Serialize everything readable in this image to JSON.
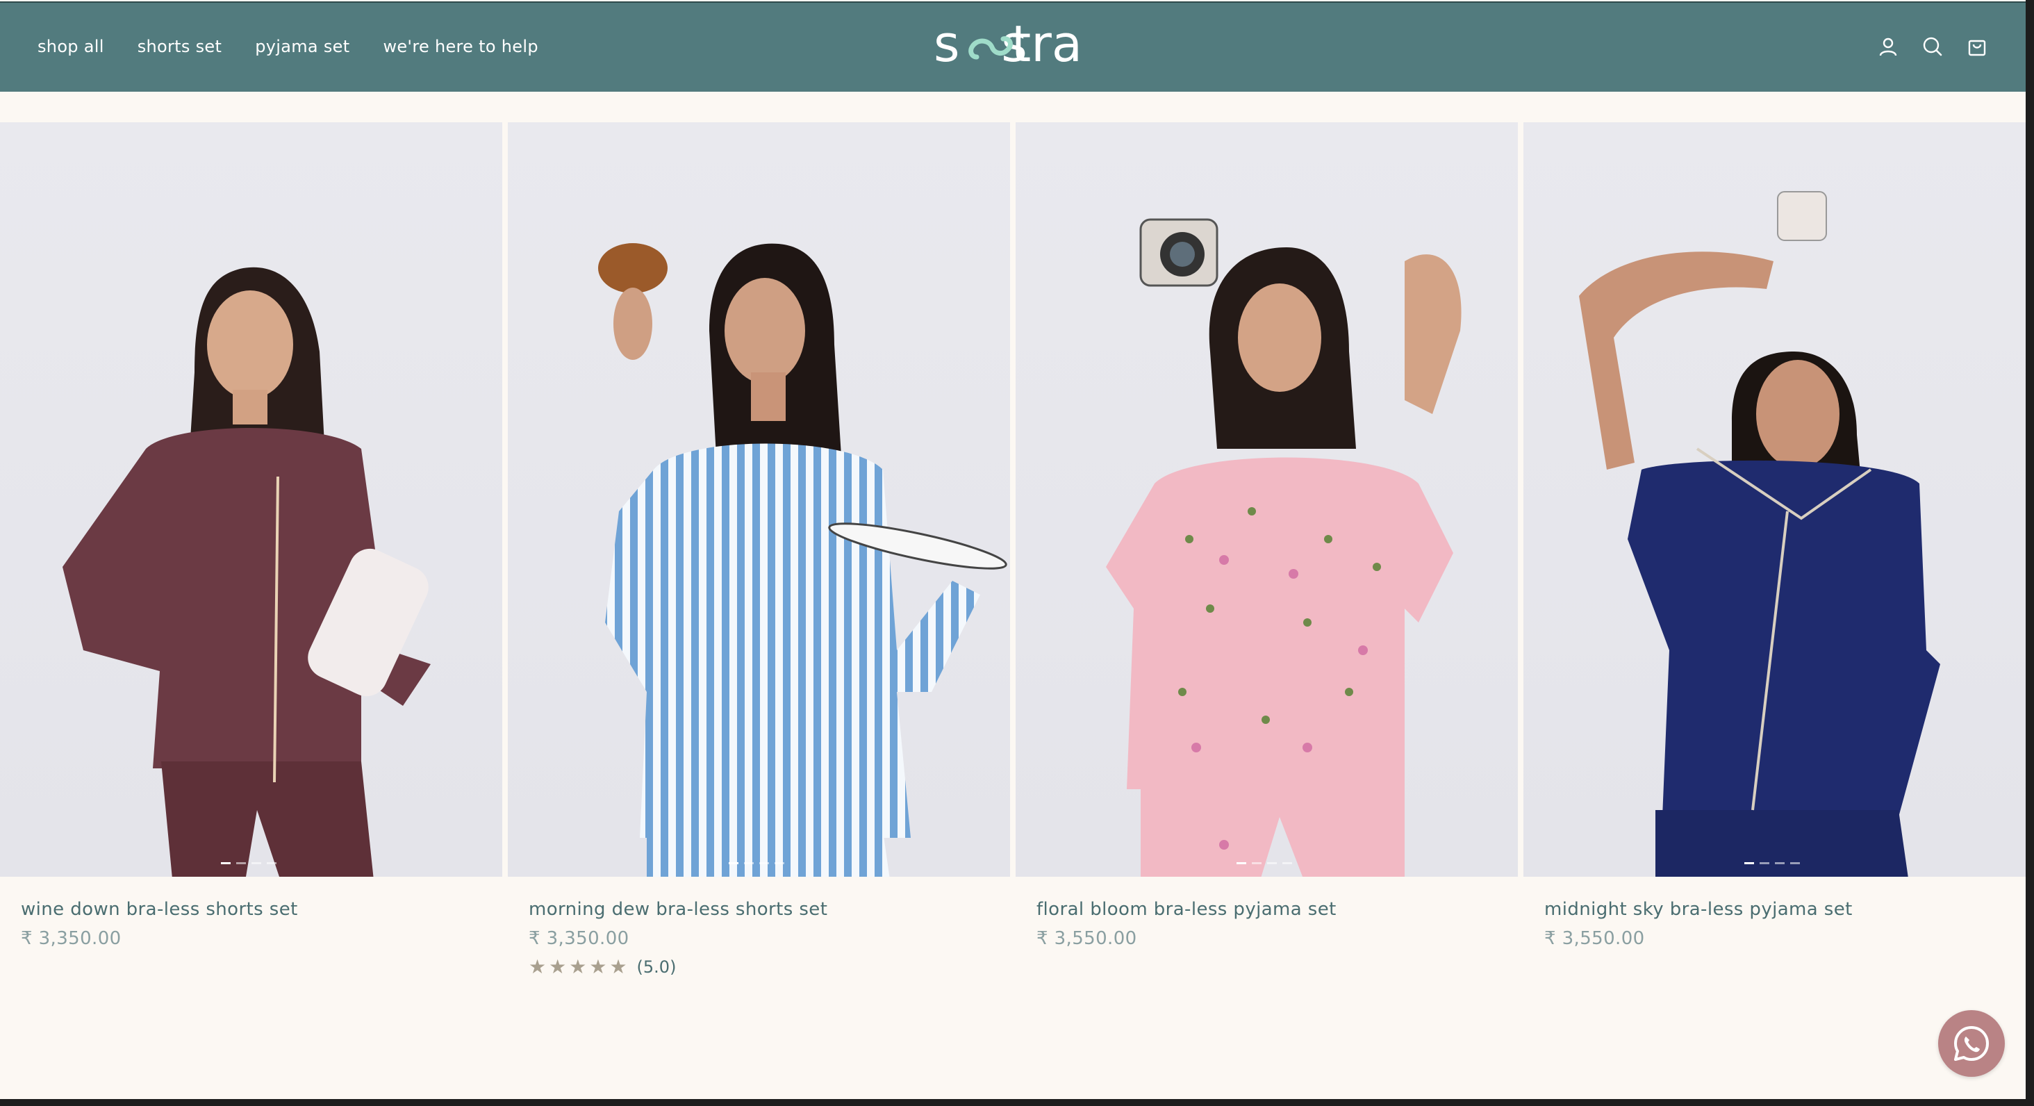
{
  "header": {
    "logo_text": "sestra",
    "nav": [
      "shop all",
      "shorts set",
      "pyjama set",
      "we're here to help"
    ],
    "icons": [
      "account-icon",
      "search-icon",
      "cart-icon"
    ]
  },
  "colors": {
    "header_bg": "#527b7e",
    "page_bg": "#fcf8f3",
    "title_text": "#4a6d70",
    "price_text": "#8a9fa1",
    "whatsapp_button": "#b98385"
  },
  "products": [
    {
      "title": "wine down bra-less shorts set",
      "price": "₹ 3,350.00",
      "image_carousel": {
        "slides": 4,
        "active_slide": 1
      },
      "garment_color": "#6b3a44",
      "rating": null
    },
    {
      "title": "morning dew bra-less shorts set",
      "price": "₹ 3,350.00",
      "image_carousel": {
        "slides": 4,
        "active_slide": 1
      },
      "garment_color": "#6fa3d6",
      "rating": {
        "stars": 5,
        "text": "(5.0)"
      }
    },
    {
      "title": "floral bloom bra-less pyjama set",
      "price": "₹ 3,550.00",
      "image_carousel": {
        "slides": 4,
        "active_slide": 1
      },
      "garment_color": "#f2b9c4",
      "rating": null
    },
    {
      "title": "midnight sky bra-less pyjama set",
      "price": "₹ 3,550.00",
      "image_carousel": {
        "slides": 4,
        "active_slide": 1
      },
      "garment_color": "#1f2b6e",
      "rating": null
    }
  ],
  "floating": {
    "icon": "whatsapp-icon"
  }
}
